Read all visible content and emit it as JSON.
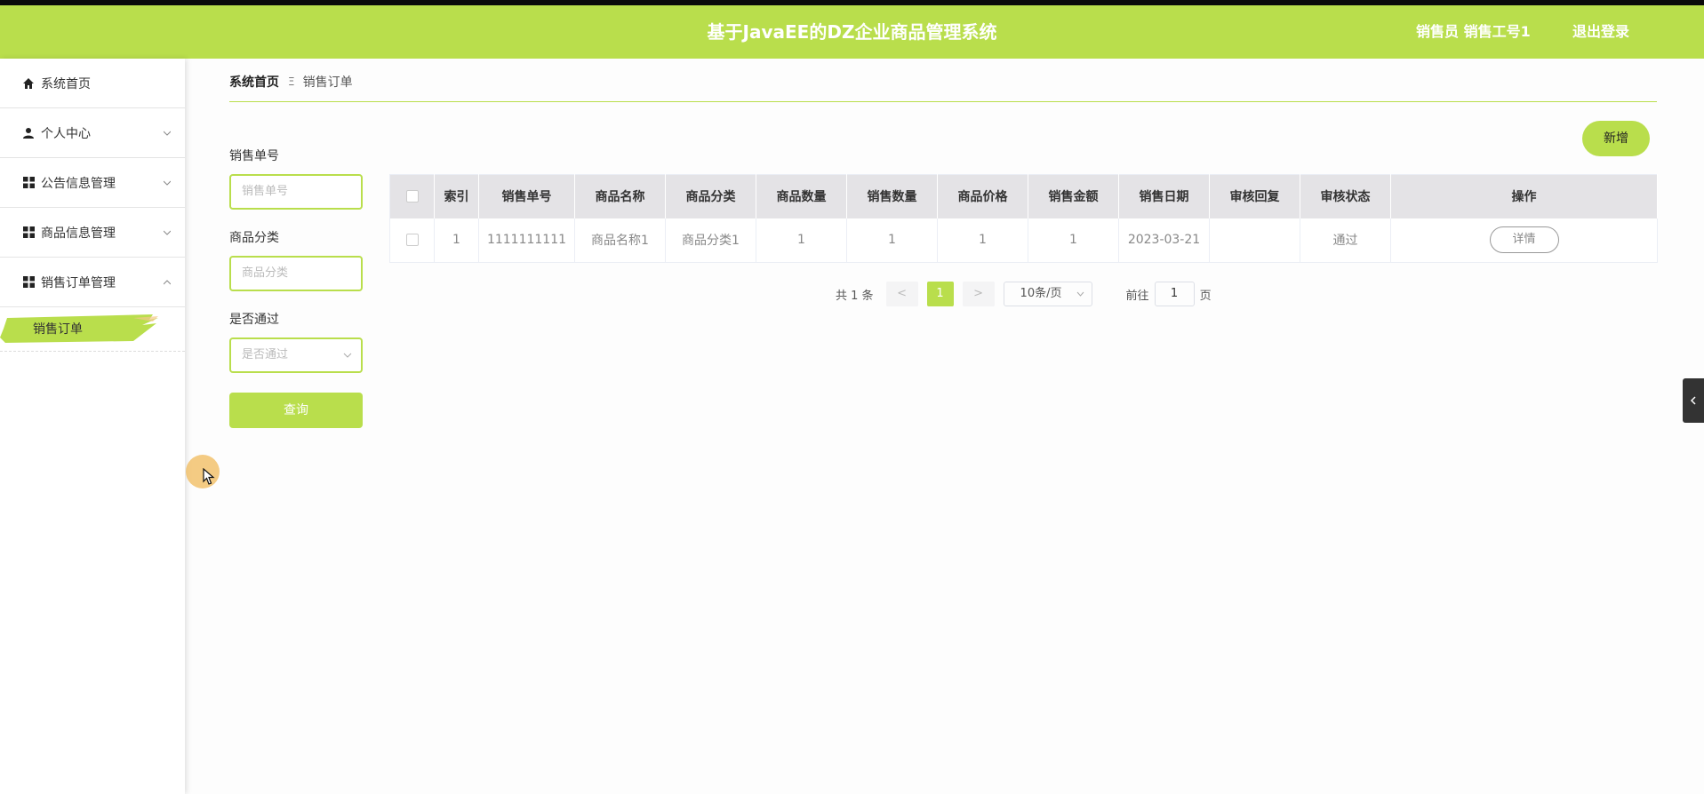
{
  "header": {
    "title": "基于JavaEE的DZ企业商品管理系统",
    "user": "销售员 销售工号1",
    "logout": "退出登录"
  },
  "sidebar": {
    "items": [
      {
        "label": "系统首页",
        "icon": "home-icon"
      },
      {
        "label": "个人中心",
        "icon": "user-icon"
      },
      {
        "label": "公告信息管理",
        "icon": "grid-icon"
      },
      {
        "label": "商品信息管理",
        "icon": "grid-icon"
      },
      {
        "label": "销售订单管理",
        "icon": "grid-icon"
      }
    ],
    "sub_active": "销售订单"
  },
  "breadcrumb": {
    "home": "系统首页",
    "separator": "Ξ",
    "current": "销售订单"
  },
  "filter": {
    "order_no_label": "销售单号",
    "order_no_placeholder": "销售单号",
    "category_label": "商品分类",
    "category_placeholder": "商品分类",
    "passed_label": "是否通过",
    "passed_placeholder": "是否通过",
    "search_button": "查询"
  },
  "toolbar": {
    "add_button": "新增"
  },
  "table": {
    "headers": [
      "索引",
      "销售单号",
      "商品名称",
      "商品分类",
      "商品数量",
      "销售数量",
      "商品价格",
      "销售金额",
      "销售日期",
      "审核回复",
      "审核状态",
      "操作"
    ],
    "rows": [
      {
        "index": "1",
        "order_no": "1111111111",
        "product_name": "商品名称1",
        "category": "商品分类1",
        "product_qty": "1",
        "sale_qty": "1",
        "price": "1",
        "amount": "1",
        "date": "2023-03-21",
        "reply": "",
        "status": "通过",
        "action": "详情"
      }
    ]
  },
  "pagination": {
    "total": "共 1 条",
    "prev": "<",
    "current_page": "1",
    "next": ">",
    "page_size": "10条/页",
    "goto_label": "前往",
    "goto_value": "1",
    "page_suffix": "页"
  },
  "colors": {
    "accent": "#b9de4c",
    "table_header_bg": "#e4e3e6"
  }
}
